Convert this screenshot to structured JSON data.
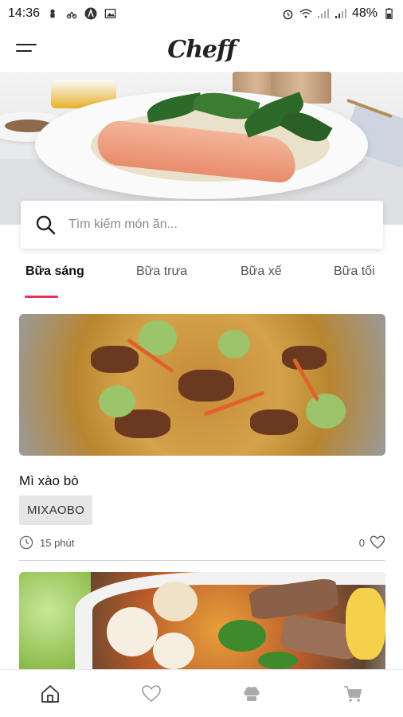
{
  "status_bar": {
    "time": "14:36",
    "battery": "48%"
  },
  "header": {
    "brand": "Cheff",
    "menu_icon": "hamburger-menu-icon"
  },
  "search": {
    "placeholder": "Tìm kiếm món ăn...",
    "icon": "search-icon"
  },
  "tabs": [
    {
      "label": "Bữa sáng",
      "active": true
    },
    {
      "label": "Bữa trưa",
      "active": false
    },
    {
      "label": "Bữa xế",
      "active": false
    },
    {
      "label": "Bữa tối",
      "active": false
    }
  ],
  "accent_color": "#e0335a",
  "recipes": [
    {
      "title": "Mì xào bò",
      "tag": "MIXAOBO",
      "time": "15 phút",
      "likes": "0"
    },
    {
      "title": "",
      "tag": "",
      "time": "",
      "likes": ""
    }
  ],
  "bottom_nav": [
    {
      "name": "home",
      "icon": "home-icon",
      "active": true
    },
    {
      "name": "favorites",
      "icon": "heart-icon",
      "active": false
    },
    {
      "name": "chef",
      "icon": "chef-hat-icon",
      "active": false
    },
    {
      "name": "cart",
      "icon": "cart-icon",
      "active": false
    }
  ]
}
